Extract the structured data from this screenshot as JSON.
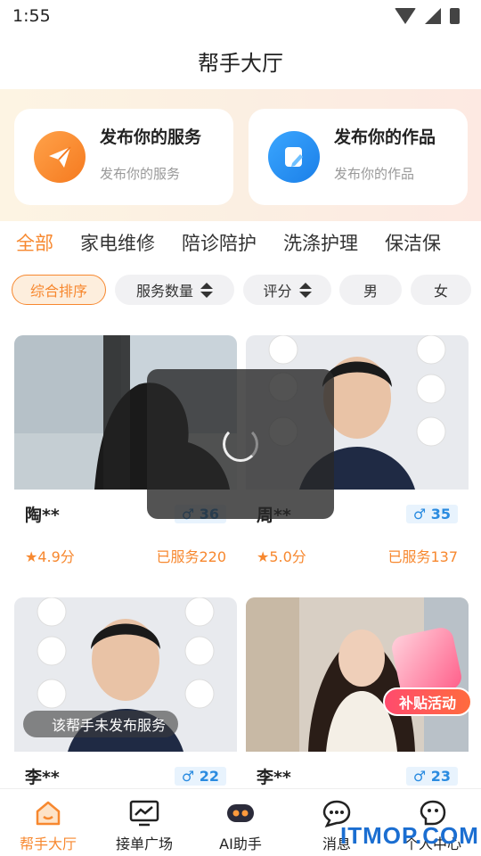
{
  "status_bar": {
    "time": "1:55"
  },
  "header": {
    "title": "帮手大厅"
  },
  "publish": {
    "service": {
      "title": "发布你的服务",
      "subtitle": "发布你的服务",
      "icon": "paper-plane-icon"
    },
    "works": {
      "title": "发布你的作品",
      "subtitle": "发布你的作品",
      "icon": "edit-note-icon"
    }
  },
  "tabs": [
    "全部",
    "家电维修",
    "陪诊陪护",
    "洗涤护理",
    "保洁保"
  ],
  "filters": [
    {
      "label": "综合排序",
      "active": true
    },
    {
      "label": "服务数量",
      "sortable": true
    },
    {
      "label": "评分",
      "sortable": true
    },
    {
      "label": "男"
    },
    {
      "label": "女"
    }
  ],
  "cards": [
    {
      "name": "陶**",
      "gender": "♂",
      "count": "36",
      "rating": "4.9分",
      "served": "已服务220"
    },
    {
      "name": "周**",
      "gender": "♂",
      "count": "35",
      "rating": "5.0分",
      "served": "已服务137"
    },
    {
      "name": "李**",
      "gender": "♂",
      "count": "22",
      "note": "该帮手未发布服务"
    },
    {
      "name": "李**",
      "gender": "♂",
      "count": "23"
    }
  ],
  "promo": {
    "label": "补贴活动"
  },
  "tabbar": [
    {
      "label": "帮手大厅",
      "icon": "home-icon",
      "active": true
    },
    {
      "label": "接单广场",
      "icon": "monitor-icon"
    },
    {
      "label": "AI助手",
      "icon": "robot-icon"
    },
    {
      "label": "消息",
      "icon": "chat-icon"
    },
    {
      "label": "个人中心",
      "icon": "profile-icon"
    }
  ],
  "watermark": "ITMOP.COM",
  "colors": {
    "accent": "#f7882f",
    "blue": "#2a8be0"
  }
}
